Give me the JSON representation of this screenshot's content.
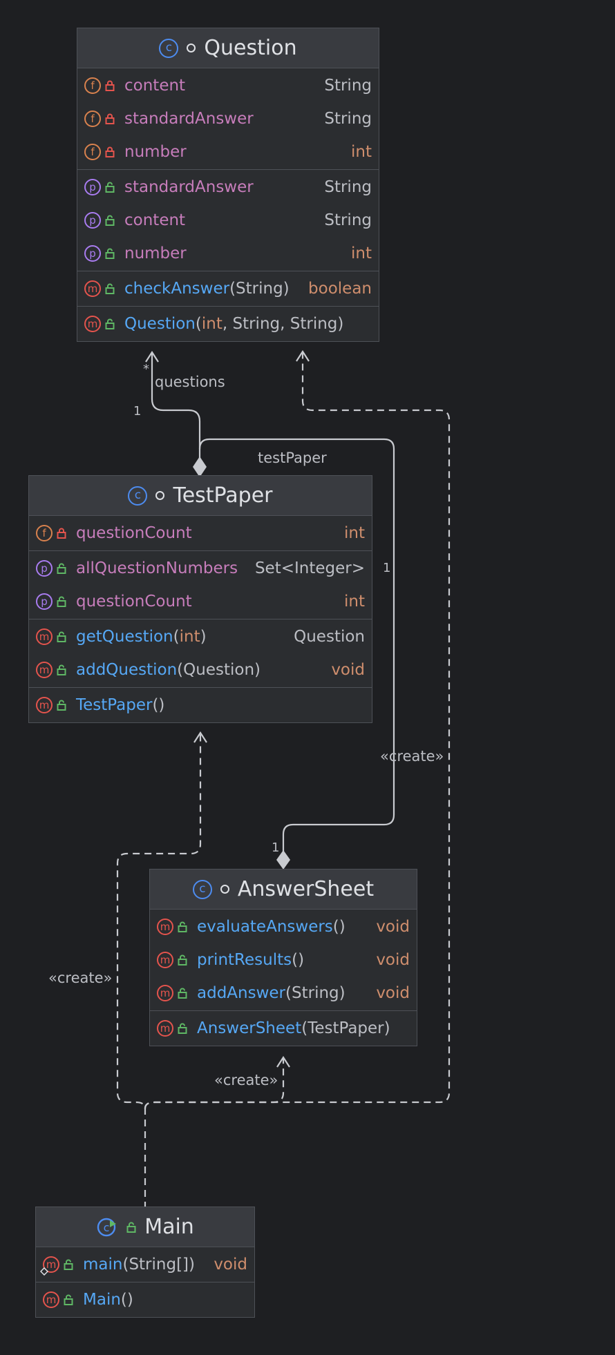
{
  "classes": {
    "question": {
      "name": "Question",
      "fields": [
        {
          "name": "content",
          "type": "String"
        },
        {
          "name": "standardAnswer",
          "type": "String"
        },
        {
          "name": "number",
          "type": "int"
        }
      ],
      "properties": [
        {
          "name": "standardAnswer",
          "type": "String"
        },
        {
          "name": "content",
          "type": "String"
        },
        {
          "name": "number",
          "type": "int"
        }
      ],
      "methods": [
        {
          "name": "checkAnswer",
          "params": "(String)",
          "type": "boolean"
        }
      ],
      "constructors": [
        {
          "name": "Question",
          "open": "(",
          "p1": "int",
          "rest": ", String, String)"
        }
      ]
    },
    "testpaper": {
      "name": "TestPaper",
      "fields": [
        {
          "name": "questionCount",
          "type": "int"
        }
      ],
      "properties": [
        {
          "name": "allQuestionNumbers",
          "type": "Set<Integer>"
        },
        {
          "name": "questionCount",
          "type": "int"
        }
      ],
      "methods": [
        {
          "name": "getQuestion",
          "open": "(",
          "p1": "int",
          "close": ")",
          "type": "Question"
        },
        {
          "name": "addQuestion",
          "params": "(Question)",
          "type": "void"
        }
      ],
      "constructors": [
        {
          "name": "TestPaper",
          "params": "()"
        }
      ]
    },
    "answersheet": {
      "name": "AnswerSheet",
      "methods": [
        {
          "name": "evaluateAnswers",
          "params": "()",
          "type": "void"
        },
        {
          "name": "printResults",
          "params": "()",
          "type": "void"
        },
        {
          "name": "addAnswer",
          "params": "(String)",
          "type": "void"
        }
      ],
      "constructors": [
        {
          "name": "AnswerSheet",
          "params": "(TestPaper)"
        }
      ]
    },
    "main": {
      "name": "Main",
      "methods": [
        {
          "name": "main",
          "params": "(String[])",
          "type": "void"
        }
      ],
      "constructors": [
        {
          "name": "Main",
          "params": "()"
        }
      ]
    }
  },
  "relations": {
    "questions_role": "questions",
    "questions_many": "*",
    "questions_one": "1",
    "testpaper_role": "testPaper",
    "testpaper_one": "1",
    "answersheet_one": "1",
    "create_question": "«create»",
    "create_testpaper": "«create»",
    "create_answersheet": "«create»"
  },
  "icons": {
    "class": "c",
    "field": "f",
    "property": "p",
    "method": "m"
  },
  "colors": {
    "background": "#1e1f22",
    "box": "#2b2d30",
    "header": "#393b40",
    "field_name": "#c77dbb",
    "method_name": "#56a8f5",
    "primitive_type": "#cf8e6d",
    "private_lock": "#e5544d",
    "public_lock": "#5fb865",
    "edge": "#c9cbd0"
  }
}
